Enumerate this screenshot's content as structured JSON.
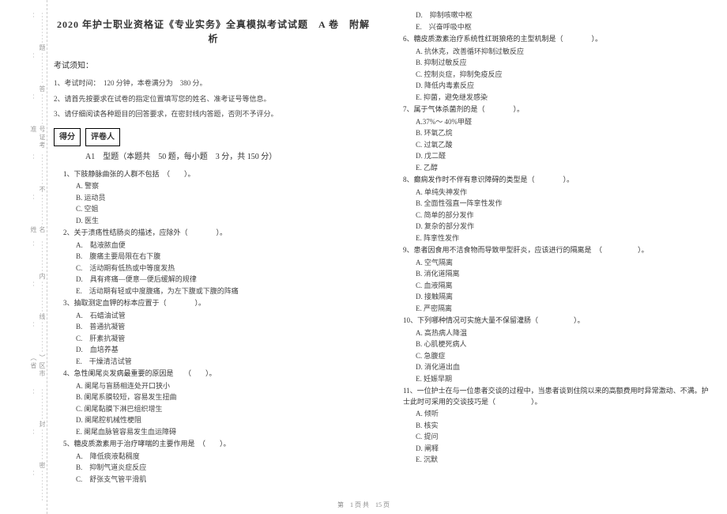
{
  "title": "2020 年护士职业资格证《专业实务》全真模拟考试试题　A 卷　附解析",
  "notice_heading": "考试须知：",
  "notice_1": "1、考试时间：　120 分钟，本卷满分为　380 分。",
  "notice_2": "2、请首先按要求在试卷的指定位置填写您的姓名、准考证号等信息。",
  "notice_3": "3、请仔细阅读各种题目的回答要求，在密封线内答题，否则不予评分。",
  "scorebox_score": "得分",
  "scorebox_reviewer": "评卷人",
  "section_a1": "A1　型题（本题共　50 题，每小题　3 分，共 150 分）",
  "sidebar": {
    "t1": "题",
    "t2": "答",
    "t3": "号证考准",
    "t4": "不",
    "t5": "名姓",
    "t6": "内",
    "t7": "线",
    "t8": "）区市（省",
    "t9": "封",
    "t10": "密",
    "dash": "︰︰︰︰︰︰"
  },
  "questions_left": [
    {
      "q": "1、下肢静脉曲张的人群不包括　（　　）。",
      "opts": [
        "A. 警察",
        "B. 运动员",
        "C. 空姐",
        "D. 医生"
      ]
    },
    {
      "q": "2、关于溃疡性结肠炎的描述，应除外（　　　　）。",
      "opts": [
        "A.　黏液脓血便",
        "B.　腹痛主要局限在右下腹",
        "C.　活动期有低热或中等度发热",
        "D.　具有疼痛—便意—便后缓解的规律",
        "E.　活动期有轻或中度腹痛，为左下腹或下腹的阵痛"
      ]
    },
    {
      "q": "3、抽取测定血钾的标本应置于（　　　　）。",
      "opts": [
        "A.　石蜡油试管",
        "B.　普通抗凝管",
        "C.　肝素抗凝管",
        "D.　血培养基",
        "E.　干燥清洁试管"
      ]
    },
    {
      "q": "4、急性阑尾炎发病最重要的原因是　　（　　）。",
      "opts": [
        "A. 阑尾与盲肠相连处开口狭小",
        "B. 阑尾系膜较短，容易发生扭曲",
        "C. 阑尾黏膜下淋巴组织增生",
        "D. 阑尾腔机械性梗阻",
        "E. 阑尾血脉管容易发生血运障碍"
      ]
    },
    {
      "q": "5、糖皮质激素用于治疗哮喘的主要作用是　（　　）。",
      "opts": [
        "A.　降低痰液黏稠度",
        "B.　抑制气道炎症反应",
        "C.　舒张支气管平滑肌"
      ]
    }
  ],
  "questions_right_extra_opts": [
    "D.　抑制咳嗽中枢",
    "E.　兴奋呼吸中枢"
  ],
  "questions_right": [
    {
      "q": "6、糖皮质激素治疗系统性红斑狼疮的主型机制是（　　　　）。",
      "opts": [
        "A. 抗休克，改善循环抑制过敏反应",
        "B. 抑制过敏反应",
        "C. 控制炎症，抑制免疫反应",
        "D. 降低内毒素反应",
        "E. 抑菌，避免继发感染"
      ]
    },
    {
      "q": "7、属于气体杀菌剂的是（　　　　）。",
      "opts": [
        "A.37%～ 40%甲醛",
        "B. 环氧乙烷",
        "C. 过氧乙酸",
        "D. 戊二醛",
        "E. 乙醇"
      ]
    },
    {
      "q": "8、癫痫发作时不伴有意识障碍的类型是（　　　　）。",
      "opts": [
        "A. 单纯失神发作",
        "B. 全面性强直一阵挛性发作",
        "C. 简单的部分发作",
        "D. 复杂的部分发作",
        "E. 阵挛性发作"
      ]
    },
    {
      "q": "9、患者因食用不洁食物而导致甲型肝炎，应该进行的隔离是　（　　　　　）。",
      "opts": [
        "A. 空气隔离",
        "B. 消化道隔离",
        "C. 血液隔离",
        "D. 接触隔离",
        "E. 严密隔离"
      ]
    },
    {
      "q": "10、下列哪种情况可实施大量不保留灌肠（　　　　　）。",
      "opts": [
        "A. 高热病人降温",
        "B. 心肌梗死病人",
        "C. 急腹症",
        "D. 消化道出血",
        "E. 妊娠早期"
      ]
    },
    {
      "q": "11、一位护士在与一位患者交谈的过程中，当患者谈到住院以来的高额费用时异常激动、不满。护士此时可采用的交谈技巧是（　　　　　）。",
      "opts": [
        "A. 倾听",
        "B. 核实",
        "C. 提问",
        "D. 阐释",
        "E. 沉默"
      ]
    }
  ],
  "footer": "第　1 页 共　15 页"
}
